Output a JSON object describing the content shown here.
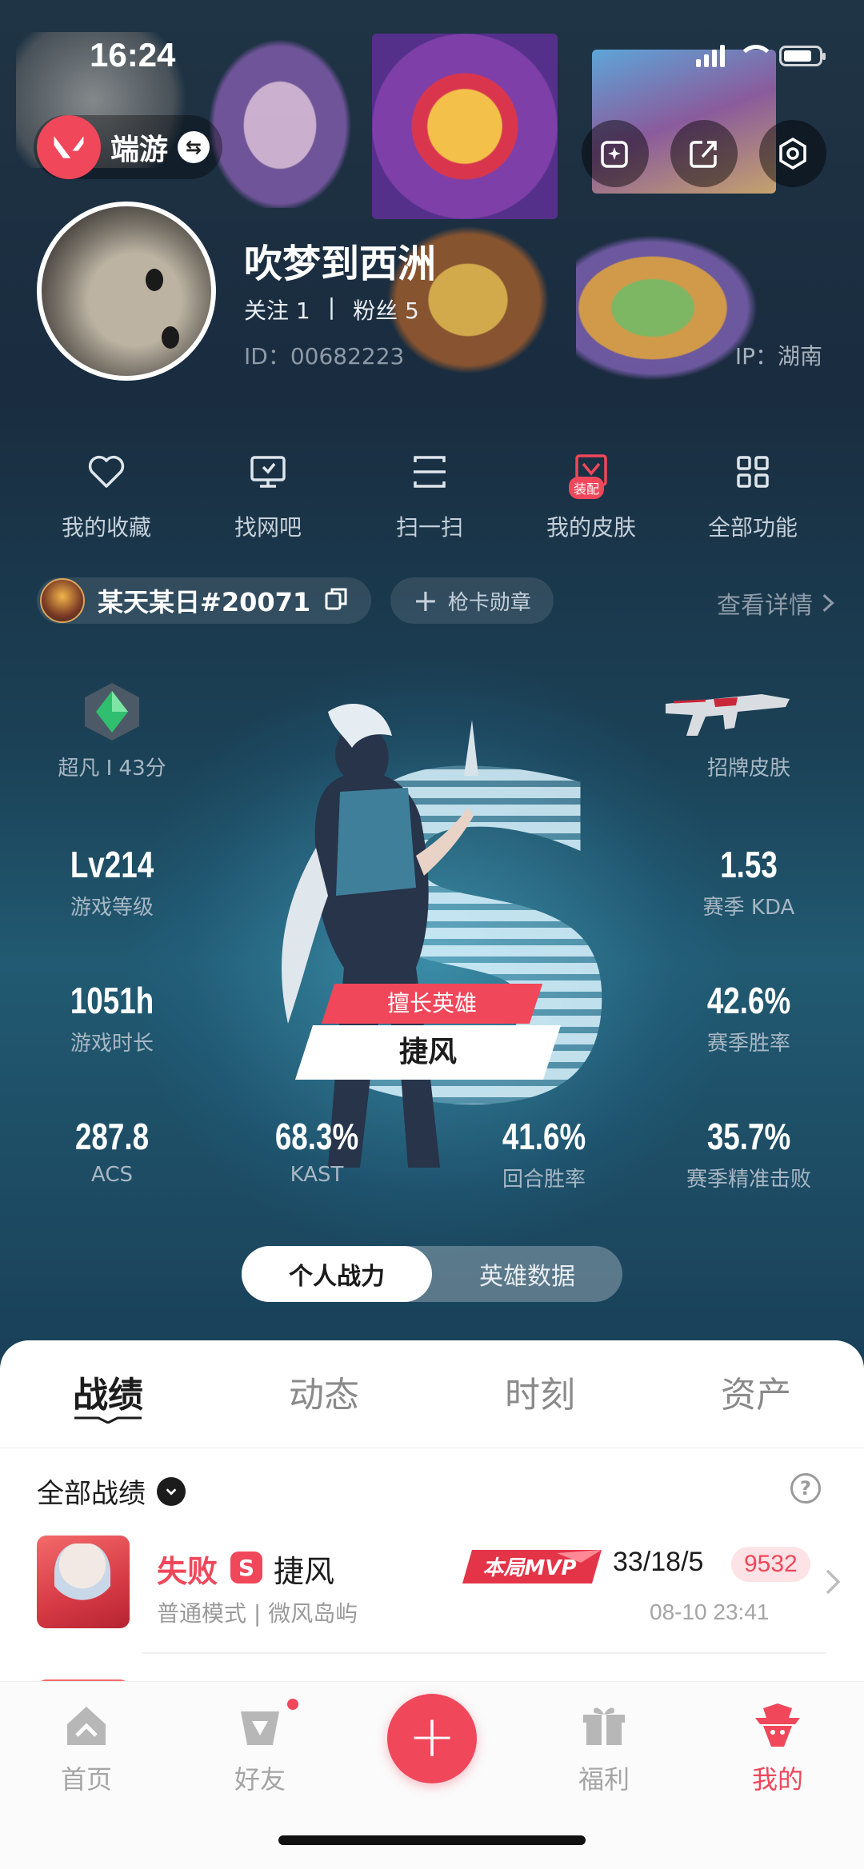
{
  "status_bar": {
    "time": "16:24"
  },
  "header": {
    "app_name": "端游",
    "swap_icon": "⇆",
    "buttons": [
      "edit-sticker-icon",
      "share-icon",
      "settings-icon"
    ]
  },
  "profile": {
    "username": "吹梦到西洲",
    "following": "关注 1",
    "separator": "|",
    "followers": "粉丝 5",
    "id": "ID：00682223",
    "ip": "IP：湖南"
  },
  "quick_actions": [
    {
      "label": "我的收藏",
      "icon": "heart-icon"
    },
    {
      "label": "找网吧",
      "icon": "monitor-icon"
    },
    {
      "label": "扫一扫",
      "icon": "scan-icon"
    },
    {
      "label": "我的皮肤",
      "icon": "skin-icon",
      "badge": "装配"
    },
    {
      "label": "全部功能",
      "icon": "grid-icon"
    }
  ],
  "player": {
    "tag": "某天某日#20071",
    "card_button": "枪卡勋章",
    "detail_link": "查看详情"
  },
  "stats": {
    "rank": {
      "label": "超凡 I 43分"
    },
    "signature_skin": {
      "label": "招牌皮肤"
    },
    "level": {
      "value": "Lv214",
      "label": "游戏等级"
    },
    "kda": {
      "value": "1.53",
      "label": "赛季 KDA"
    },
    "playtime": {
      "value": "1051h",
      "label": "游戏时长"
    },
    "winrate": {
      "value": "42.6%",
      "label": "赛季胜率"
    },
    "acs": {
      "value": "287.8",
      "label": "ACS"
    },
    "kast": {
      "value": "68.3%",
      "label": "KAST"
    },
    "round_winrate": {
      "value": "41.6%",
      "label": "回合胜率"
    },
    "headshot": {
      "value": "35.7%",
      "label": "赛季精准击败"
    },
    "best_hero": {
      "title": "擅长英雄",
      "name": "捷风"
    },
    "big_letter": "S"
  },
  "segment": {
    "options": [
      "个人战力",
      "英雄数据"
    ],
    "selected": 0
  },
  "tabs": {
    "items": [
      "战绩",
      "动态",
      "时刻",
      "资产"
    ],
    "active": 0
  },
  "records": {
    "filter_label": "全部战绩",
    "help": "?",
    "matches": [
      {
        "result": "失败",
        "mode_badge": "S",
        "hero": "捷风",
        "mvp": "本局MVP",
        "kda": "33/18/5",
        "score": "9532",
        "mode": "普通模式 | 微风岛屿",
        "time": "08-10 23:41"
      }
    ]
  },
  "bottom_nav": {
    "items": [
      {
        "label": "首页",
        "icon": "home-icon"
      },
      {
        "label": "好友",
        "icon": "friends-icon",
        "has_dot": true
      },
      {
        "label": "福利",
        "icon": "gift-icon"
      },
      {
        "label": "我的",
        "icon": "profile-icon",
        "active": true
      }
    ],
    "fab": "+"
  },
  "colors": {
    "accent": "#f0475b",
    "bg_dark": "#13253a",
    "sheet": "#ffffff"
  }
}
